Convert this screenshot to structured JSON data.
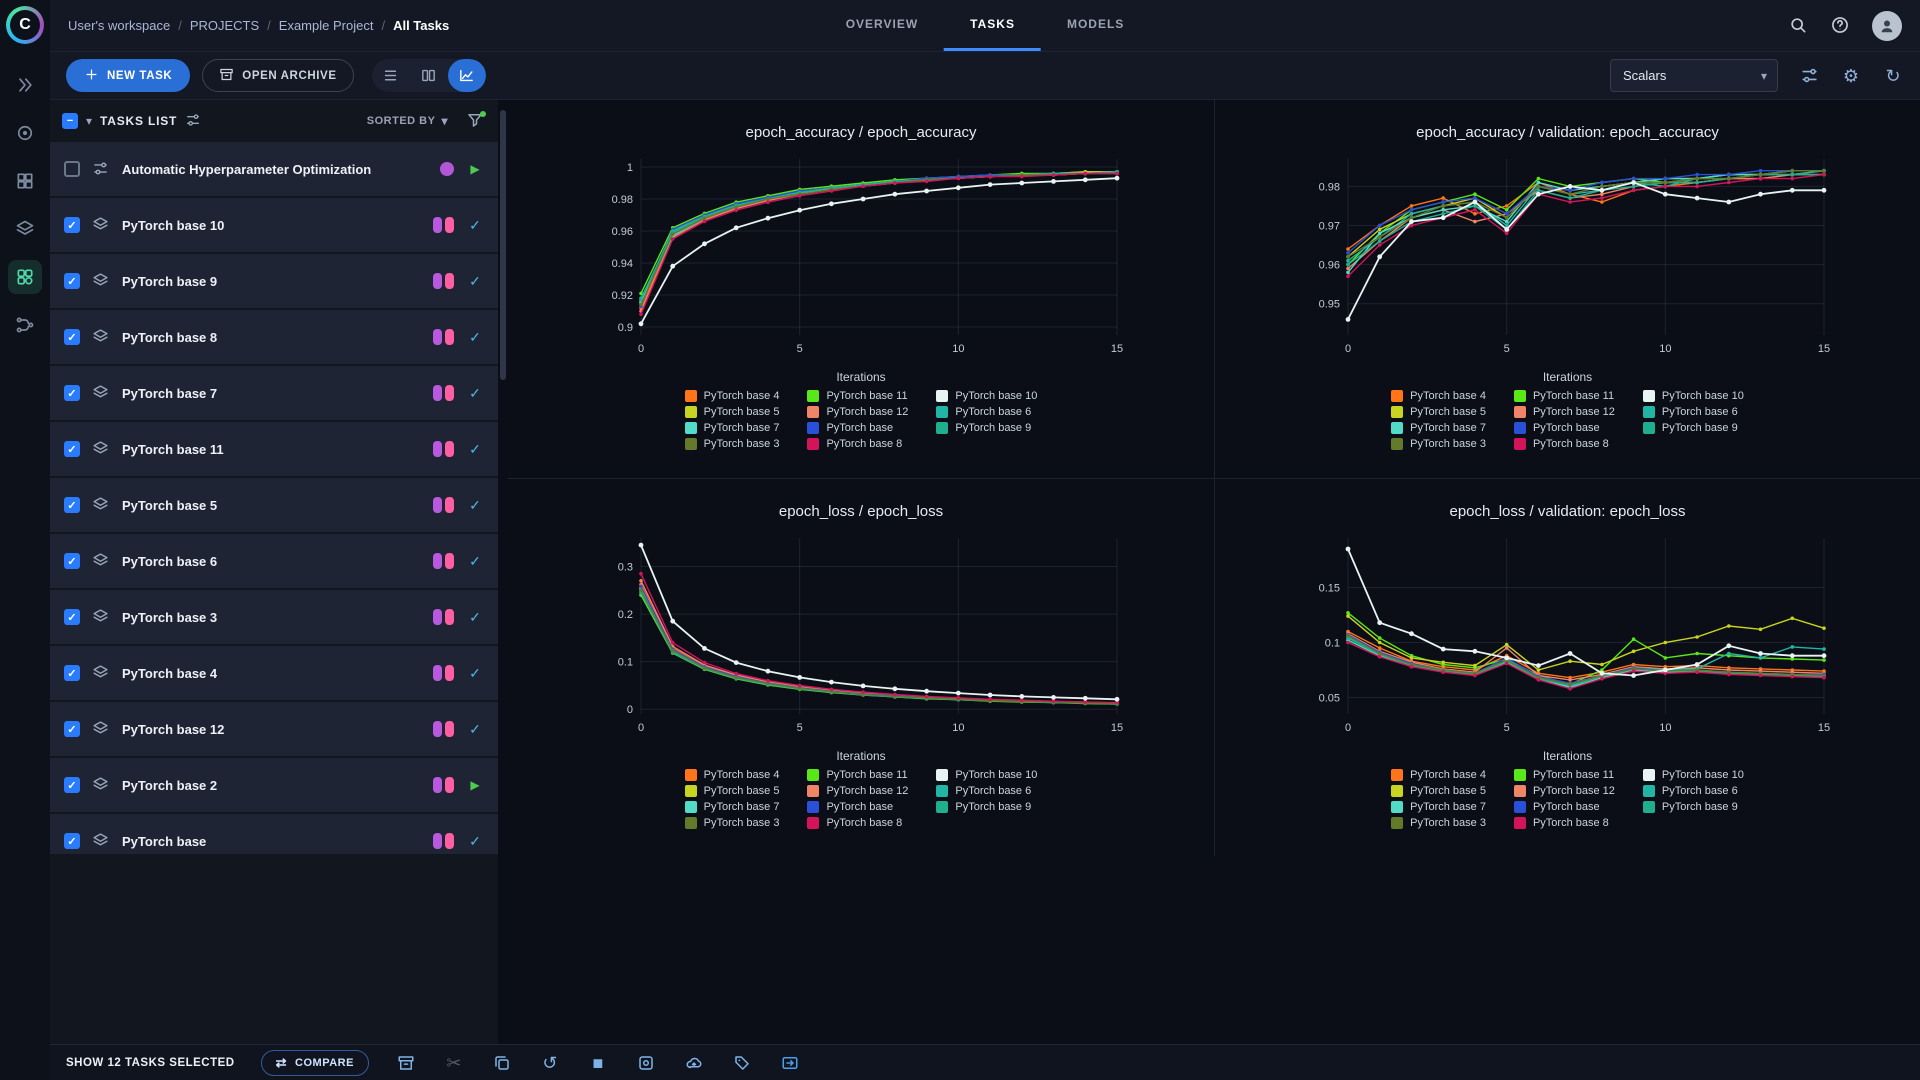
{
  "sidebar": {
    "items": [
      {
        "icon": "chevrons",
        "active": false
      },
      {
        "icon": "target",
        "active": false
      },
      {
        "icon": "grid",
        "active": false
      },
      {
        "icon": "layers",
        "active": false
      },
      {
        "icon": "apps",
        "active": true
      },
      {
        "icon": "pipeline",
        "active": false
      }
    ]
  },
  "header": {
    "breadcrumb": [
      {
        "label": "User's workspace",
        "current": false
      },
      {
        "label": "PROJECTS",
        "current": false
      },
      {
        "label": "Example Project",
        "current": false
      },
      {
        "label": "All Tasks",
        "current": true
      }
    ],
    "tabs": [
      {
        "label": "OVERVIEW",
        "active": false
      },
      {
        "label": "TASKS",
        "active": true
      },
      {
        "label": "MODELS",
        "active": false
      }
    ]
  },
  "toolbar": {
    "new_task": "NEW TASK",
    "open_archive": "OPEN ARCHIVE",
    "view_select": "Scalars"
  },
  "tasks_panel": {
    "title": "TASKS LIST",
    "sorted_by": "SORTED BY",
    "tasks": [
      {
        "name": "Automatic Hyperparameter Optimization",
        "type": "hpo",
        "checked": false,
        "status": "running"
      },
      {
        "name": "PyTorch base 10",
        "type": "training",
        "checked": true,
        "status": "completed"
      },
      {
        "name": "PyTorch base 9",
        "type": "training",
        "checked": true,
        "status": "completed"
      },
      {
        "name": "PyTorch base 8",
        "type": "training",
        "checked": true,
        "status": "completed"
      },
      {
        "name": "PyTorch base 7",
        "type": "training",
        "checked": true,
        "status": "completed"
      },
      {
        "name": "PyTorch base 11",
        "type": "training",
        "checked": true,
        "status": "completed"
      },
      {
        "name": "PyTorch base 5",
        "type": "training",
        "checked": true,
        "status": "completed"
      },
      {
        "name": "PyTorch base 6",
        "type": "training",
        "checked": true,
        "status": "completed"
      },
      {
        "name": "PyTorch base 3",
        "type": "training",
        "checked": true,
        "status": "completed"
      },
      {
        "name": "PyTorch base 4",
        "type": "training",
        "checked": true,
        "status": "completed"
      },
      {
        "name": "PyTorch base 12",
        "type": "training",
        "checked": true,
        "status": "completed"
      },
      {
        "name": "PyTorch base 2",
        "type": "training",
        "checked": true,
        "status": "running"
      },
      {
        "name": "PyTorch base",
        "type": "training",
        "checked": true,
        "status": "completed"
      }
    ]
  },
  "series_meta": [
    {
      "name": "PyTorch base 4",
      "color": "#ff7518"
    },
    {
      "name": "PyTorch base 11",
      "color": "#59e817"
    },
    {
      "name": "PyTorch base 10",
      "color": "#e8f4f4"
    },
    {
      "name": "PyTorch base 5",
      "color": "#c9d421"
    },
    {
      "name": "PyTorch base 12",
      "color": "#ef8468"
    },
    {
      "name": "PyTorch base 6",
      "color": "#22b5a5"
    },
    {
      "name": "PyTorch base 7",
      "color": "#52dcc8"
    },
    {
      "name": "PyTorch base",
      "color": "#2b50d8"
    },
    {
      "name": "PyTorch base 9",
      "color": "#1fae8e"
    },
    {
      "name": "PyTorch base 3",
      "color": "#637a2a"
    },
    {
      "name": "PyTorch base 8",
      "color": "#d4145a"
    }
  ],
  "chart_data": [
    {
      "type": "line",
      "title": "epoch_accuracy / epoch_accuracy",
      "xlabel": "Iterations",
      "xticks": [
        0,
        5,
        10,
        15
      ],
      "yticks": [
        0.9,
        0.92,
        0.94,
        0.96,
        0.98,
        1
      ],
      "ylim": [
        0.895,
        1.005
      ],
      "values": [
        [
          0.912,
          0.958,
          0.968,
          0.975,
          0.98,
          0.984,
          0.987,
          0.989,
          0.991,
          0.992,
          0.993,
          0.994,
          0.995,
          0.996,
          0.996,
          0.997
        ],
        [
          0.921,
          0.962,
          0.971,
          0.978,
          0.982,
          0.986,
          0.988,
          0.99,
          0.992,
          0.993,
          0.994,
          0.995,
          0.996,
          0.996,
          0.997,
          0.997
        ],
        [
          0.902,
          0.938,
          0.952,
          0.962,
          0.968,
          0.973,
          0.977,
          0.98,
          0.983,
          0.985,
          0.987,
          0.989,
          0.99,
          0.991,
          0.992,
          0.993
        ],
        [
          0.916,
          0.96,
          0.97,
          0.976,
          0.981,
          0.985,
          0.987,
          0.989,
          0.991,
          0.992,
          0.993,
          0.994,
          0.995,
          0.996,
          0.997,
          0.997
        ],
        [
          0.91,
          0.956,
          0.967,
          0.974,
          0.979,
          0.983,
          0.986,
          0.988,
          0.99,
          0.992,
          0.993,
          0.994,
          0.995,
          0.995,
          0.996,
          0.996
        ],
        [
          0.918,
          0.959,
          0.969,
          0.976,
          0.981,
          0.984,
          0.987,
          0.989,
          0.991,
          0.992,
          0.994,
          0.994,
          0.995,
          0.996,
          0.996,
          0.997
        ],
        [
          0.915,
          0.957,
          0.968,
          0.975,
          0.98,
          0.984,
          0.986,
          0.989,
          0.99,
          0.992,
          0.993,
          0.994,
          0.995,
          0.995,
          0.996,
          0.997
        ],
        [
          0.913,
          0.961,
          0.97,
          0.977,
          0.981,
          0.985,
          0.987,
          0.989,
          0.991,
          0.993,
          0.994,
          0.995,
          0.995,
          0.996,
          0.996,
          0.997
        ],
        [
          0.917,
          0.96,
          0.969,
          0.976,
          0.98,
          0.984,
          0.987,
          0.989,
          0.991,
          0.992,
          0.993,
          0.994,
          0.995,
          0.996,
          0.996,
          0.997
        ],
        [
          0.914,
          0.958,
          0.968,
          0.975,
          0.98,
          0.983,
          0.986,
          0.988,
          0.99,
          0.992,
          0.993,
          0.994,
          0.995,
          0.995,
          0.996,
          0.996
        ],
        [
          0.908,
          0.955,
          0.966,
          0.973,
          0.978,
          0.982,
          0.985,
          0.988,
          0.99,
          0.991,
          0.993,
          0.994,
          0.994,
          0.995,
          0.996,
          0.996
        ]
      ]
    },
    {
      "type": "line",
      "title": "epoch_accuracy / validation: epoch_accuracy",
      "xlabel": "Iterations",
      "xticks": [
        0,
        5,
        10,
        15
      ],
      "yticks": [
        0.95,
        0.96,
        0.97,
        0.98
      ],
      "ylim": [
        0.942,
        0.987
      ],
      "values": [
        [
          0.964,
          0.97,
          0.975,
          0.977,
          0.973,
          0.975,
          0.981,
          0.978,
          0.976,
          0.979,
          0.98,
          0.981,
          0.982,
          0.982,
          0.983,
          0.983
        ],
        [
          0.96,
          0.968,
          0.974,
          0.976,
          0.978,
          0.974,
          0.982,
          0.98,
          0.981,
          0.982,
          0.981,
          0.982,
          0.983,
          0.983,
          0.984,
          0.984
        ],
        [
          0.946,
          0.962,
          0.971,
          0.972,
          0.976,
          0.969,
          0.978,
          0.98,
          0.979,
          0.981,
          0.978,
          0.977,
          0.976,
          0.978,
          0.979,
          0.979
        ],
        [
          0.962,
          0.969,
          0.973,
          0.975,
          0.977,
          0.972,
          0.98,
          0.979,
          0.98,
          0.981,
          0.982,
          0.982,
          0.983,
          0.983,
          0.983,
          0.984
        ],
        [
          0.959,
          0.966,
          0.972,
          0.974,
          0.971,
          0.973,
          0.979,
          0.977,
          0.978,
          0.98,
          0.981,
          0.981,
          0.982,
          0.982,
          0.983,
          0.983
        ],
        [
          0.961,
          0.967,
          0.973,
          0.975,
          0.976,
          0.97,
          0.98,
          0.978,
          0.979,
          0.981,
          0.98,
          0.982,
          0.982,
          0.983,
          0.983,
          0.984
        ],
        [
          0.958,
          0.968,
          0.972,
          0.974,
          0.975,
          0.971,
          0.981,
          0.979,
          0.98,
          0.981,
          0.982,
          0.982,
          0.983,
          0.983,
          0.984,
          0.984
        ],
        [
          0.963,
          0.97,
          0.974,
          0.976,
          0.977,
          0.973,
          0.98,
          0.979,
          0.981,
          0.982,
          0.982,
          0.983,
          0.983,
          0.984,
          0.984,
          0.984
        ],
        [
          0.96,
          0.966,
          0.971,
          0.973,
          0.975,
          0.969,
          0.979,
          0.977,
          0.979,
          0.98,
          0.981,
          0.981,
          0.982,
          0.983,
          0.983,
          0.983
        ],
        [
          0.962,
          0.967,
          0.972,
          0.975,
          0.976,
          0.972,
          0.98,
          0.978,
          0.98,
          0.981,
          0.981,
          0.982,
          0.982,
          0.983,
          0.984,
          0.984
        ],
        [
          0.957,
          0.965,
          0.97,
          0.972,
          0.974,
          0.968,
          0.978,
          0.976,
          0.977,
          0.979,
          0.98,
          0.98,
          0.981,
          0.982,
          0.982,
          0.983
        ]
      ]
    },
    {
      "type": "line",
      "title": "epoch_loss / epoch_loss",
      "xlabel": "Iterations",
      "xticks": [
        0,
        5,
        10,
        15
      ],
      "yticks": [
        0,
        0.1,
        0.2,
        0.3
      ],
      "ylim": [
        -0.01,
        0.36
      ],
      "values": [
        [
          0.262,
          0.128,
          0.09,
          0.07,
          0.056,
          0.046,
          0.039,
          0.033,
          0.029,
          0.025,
          0.022,
          0.02,
          0.018,
          0.016,
          0.014,
          0.013
        ],
        [
          0.24,
          0.118,
          0.084,
          0.064,
          0.051,
          0.042,
          0.035,
          0.03,
          0.026,
          0.022,
          0.02,
          0.017,
          0.015,
          0.014,
          0.012,
          0.011
        ],
        [
          0.345,
          0.185,
          0.128,
          0.098,
          0.08,
          0.067,
          0.057,
          0.049,
          0.043,
          0.038,
          0.034,
          0.03,
          0.027,
          0.025,
          0.023,
          0.021
        ],
        [
          0.255,
          0.122,
          0.087,
          0.067,
          0.053,
          0.044,
          0.037,
          0.031,
          0.027,
          0.024,
          0.021,
          0.018,
          0.016,
          0.015,
          0.013,
          0.012
        ],
        [
          0.27,
          0.132,
          0.093,
          0.072,
          0.058,
          0.048,
          0.04,
          0.034,
          0.03,
          0.026,
          0.023,
          0.02,
          0.018,
          0.016,
          0.015,
          0.013
        ],
        [
          0.248,
          0.12,
          0.086,
          0.066,
          0.052,
          0.043,
          0.036,
          0.031,
          0.026,
          0.023,
          0.02,
          0.018,
          0.016,
          0.014,
          0.013,
          0.012
        ],
        [
          0.252,
          0.124,
          0.088,
          0.068,
          0.054,
          0.045,
          0.038,
          0.032,
          0.028,
          0.024,
          0.021,
          0.019,
          0.017,
          0.015,
          0.013,
          0.012
        ],
        [
          0.258,
          0.126,
          0.089,
          0.069,
          0.055,
          0.045,
          0.038,
          0.032,
          0.028,
          0.024,
          0.021,
          0.019,
          0.017,
          0.015,
          0.014,
          0.012
        ],
        [
          0.245,
          0.119,
          0.085,
          0.065,
          0.052,
          0.043,
          0.036,
          0.03,
          0.026,
          0.023,
          0.02,
          0.018,
          0.016,
          0.014,
          0.013,
          0.011
        ],
        [
          0.25,
          0.123,
          0.087,
          0.067,
          0.054,
          0.044,
          0.037,
          0.031,
          0.027,
          0.024,
          0.021,
          0.018,
          0.016,
          0.015,
          0.013,
          0.012
        ],
        [
          0.285,
          0.14,
          0.098,
          0.075,
          0.06,
          0.05,
          0.042,
          0.036,
          0.031,
          0.027,
          0.024,
          0.021,
          0.019,
          0.017,
          0.015,
          0.014
        ]
      ]
    },
    {
      "type": "line",
      "title": "epoch_loss / validation: epoch_loss",
      "xlabel": "Iterations",
      "xticks": [
        0,
        5,
        10,
        15
      ],
      "yticks": [
        0.05,
        0.1,
        0.15
      ],
      "ylim": [
        0.035,
        0.195
      ],
      "values": [
        [
          0.11,
          0.095,
          0.083,
          0.078,
          0.075,
          0.088,
          0.072,
          0.068,
          0.073,
          0.08,
          0.078,
          0.079,
          0.077,
          0.076,
          0.075,
          0.074
        ],
        [
          0.127,
          0.104,
          0.088,
          0.08,
          0.077,
          0.085,
          0.07,
          0.062,
          0.075,
          0.103,
          0.086,
          0.09,
          0.088,
          0.086,
          0.085,
          0.084
        ],
        [
          0.185,
          0.118,
          0.108,
          0.094,
          0.092,
          0.086,
          0.079,
          0.09,
          0.072,
          0.07,
          0.075,
          0.08,
          0.097,
          0.09,
          0.088,
          0.088
        ],
        [
          0.124,
          0.1,
          0.086,
          0.082,
          0.079,
          0.098,
          0.075,
          0.083,
          0.08,
          0.092,
          0.1,
          0.105,
          0.115,
          0.112,
          0.122,
          0.113
        ],
        [
          0.108,
          0.092,
          0.082,
          0.076,
          0.073,
          0.095,
          0.07,
          0.066,
          0.071,
          0.078,
          0.076,
          0.077,
          0.075,
          0.074,
          0.073,
          0.072
        ],
        [
          0.105,
          0.09,
          0.08,
          0.075,
          0.072,
          0.084,
          0.068,
          0.06,
          0.07,
          0.077,
          0.075,
          0.076,
          0.09,
          0.086,
          0.096,
          0.094
        ],
        [
          0.102,
          0.088,
          0.079,
          0.074,
          0.071,
          0.082,
          0.067,
          0.059,
          0.068,
          0.075,
          0.073,
          0.074,
          0.072,
          0.071,
          0.07,
          0.07
        ],
        [
          0.107,
          0.091,
          0.081,
          0.075,
          0.072,
          0.086,
          0.069,
          0.063,
          0.07,
          0.077,
          0.074,
          0.075,
          0.073,
          0.072,
          0.071,
          0.071
        ],
        [
          0.104,
          0.089,
          0.079,
          0.074,
          0.071,
          0.083,
          0.067,
          0.061,
          0.069,
          0.076,
          0.074,
          0.074,
          0.072,
          0.071,
          0.07,
          0.069
        ],
        [
          0.106,
          0.09,
          0.08,
          0.075,
          0.072,
          0.084,
          0.068,
          0.062,
          0.07,
          0.076,
          0.074,
          0.075,
          0.073,
          0.072,
          0.071,
          0.07
        ],
        [
          0.1,
          0.087,
          0.078,
          0.073,
          0.07,
          0.081,
          0.066,
          0.058,
          0.067,
          0.074,
          0.072,
          0.073,
          0.071,
          0.07,
          0.069,
          0.068
        ]
      ]
    }
  ],
  "footer": {
    "selected": "SHOW 12 TASKS SELECTED",
    "compare": "COMPARE",
    "actions": [
      {
        "icon": "archive",
        "disabled": false,
        "bright": false
      },
      {
        "icon": "scissors",
        "disabled": true,
        "bright": false
      },
      {
        "icon": "clone",
        "disabled": false,
        "bright": false
      },
      {
        "icon": "history",
        "disabled": false,
        "bright": false
      },
      {
        "icon": "stop",
        "disabled": false,
        "bright": false
      },
      {
        "icon": "publish",
        "disabled": false,
        "bright": false
      },
      {
        "icon": "cloud-upload",
        "disabled": false,
        "bright": false
      },
      {
        "icon": "tag",
        "disabled": false,
        "bright": false
      },
      {
        "icon": "move-to",
        "disabled": false,
        "bright": true
      }
    ]
  }
}
